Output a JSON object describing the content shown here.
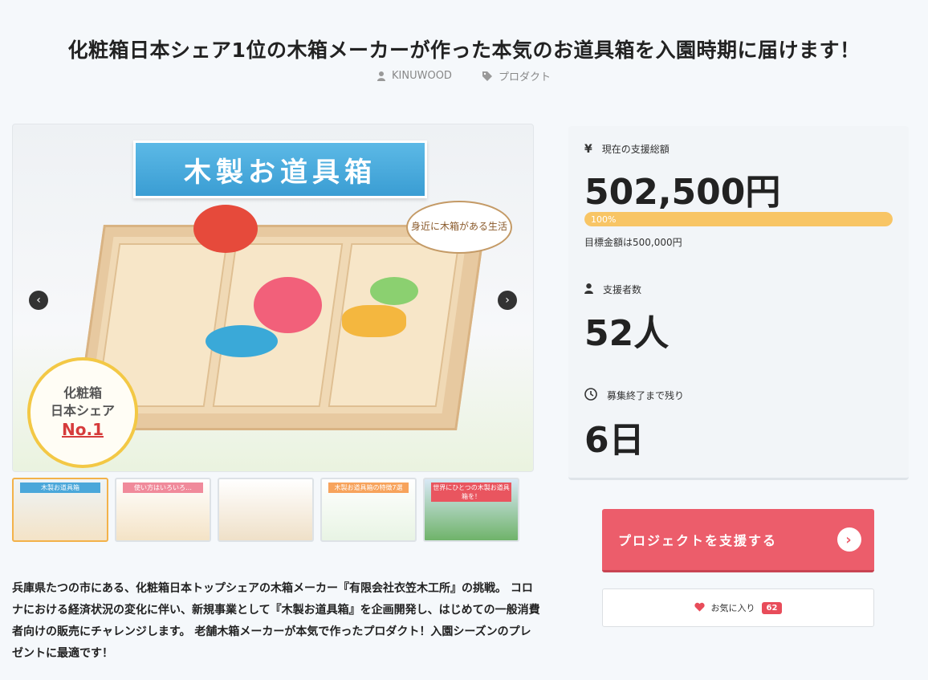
{
  "title": "化粧箱日本シェア1位の木箱メーカーが作った本気のお道具箱を入園時期に届けます！",
  "meta": {
    "author": "KINUWOOD",
    "category": "プロダクト"
  },
  "hero": {
    "banner": "木製お道具箱",
    "bubble": "身近に木箱がある生活",
    "badge_line1": "化粧箱",
    "badge_line2": "日本シェア",
    "badge_line3": "No.1"
  },
  "thumbnails": [
    {
      "label": "木製お道具箱"
    },
    {
      "label": "使い方はいろいろ…"
    },
    {
      "label": ""
    },
    {
      "label": "木製お道具箱の特徴7選"
    },
    {
      "label": "世界にひとつの木製お道具箱を！"
    }
  ],
  "description": "兵庫県たつの市にある、化粧箱日本トップシェアの木箱メーカー『有限会社衣笠木工所』の挑戦。 コロナにおける経済状況の変化に伴い、新規事業として『木製お道具箱』を企画開発し、はじめての一般消費者向けの販売にチャレンジします。 老舗木箱メーカーが本気で作ったプロダクト！入園シーズンのプレゼントに最適です！",
  "panel": {
    "total_label": "現在の支援総額",
    "total_value": "502,500円",
    "progress_text": "100%",
    "progress_fraction": 1.0,
    "goal_text": "目標金額は500,000円",
    "backers_label": "支援者数",
    "backers_value": "52人",
    "remaining_label": "募集終了まで残り",
    "remaining_value": "6日"
  },
  "support_button": "プロジェクトを支援する",
  "favorite": {
    "label": "お気に入り",
    "count": "62"
  },
  "colors": {
    "accent": "#ec5d6b",
    "progress": "#f8c565",
    "banner": "#4aa7da"
  }
}
